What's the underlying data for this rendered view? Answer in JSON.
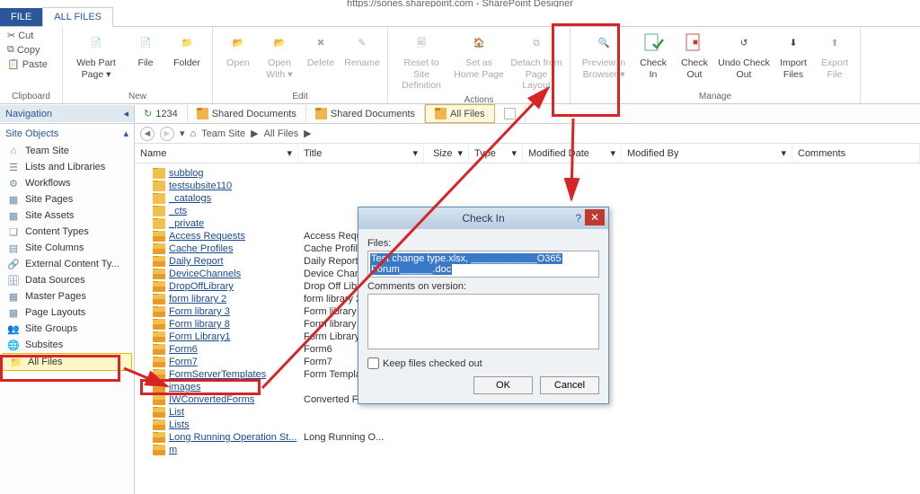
{
  "window": {
    "title": "https://sones.sharepoint.com - SharePoint Designer"
  },
  "tabs": {
    "file": "FILE",
    "all_files": "ALL FILES"
  },
  "ribbon": {
    "clipboard": {
      "label": "Clipboard",
      "cut": "Cut",
      "copy": "Copy",
      "paste": "Paste"
    },
    "new": {
      "label": "New",
      "webpart": "Web Part Page ▾",
      "file": "File",
      "folder": "Folder"
    },
    "edit": {
      "label": "Edit",
      "open": "Open",
      "openwith": "Open With ▾",
      "delete": "Delete",
      "rename": "Rename"
    },
    "actions": {
      "label": "Actions",
      "reset": "Reset to Site Definition",
      "setas": "Set as Home Page",
      "detach": "Detach from Page Layout"
    },
    "manage": {
      "label": "Manage",
      "preview": "Preview in Browser ▾",
      "checkin": "Check In",
      "checkout": "Check Out",
      "undo": "Undo Check Out",
      "import": "Import Files",
      "export": "Export File"
    }
  },
  "nav": {
    "navigation": "Navigation",
    "tabs": [
      "1234",
      "Shared Documents",
      "Shared Documents",
      "All Files"
    ],
    "active_tab": 3
  },
  "sidebar": {
    "header": "Site Objects",
    "items": [
      {
        "label": "Team Site"
      },
      {
        "label": "Lists and Libraries"
      },
      {
        "label": "Workflows"
      },
      {
        "label": "Site Pages"
      },
      {
        "label": "Site Assets"
      },
      {
        "label": "Content Types"
      },
      {
        "label": "Site Columns"
      },
      {
        "label": "External Content Ty..."
      },
      {
        "label": "Data Sources"
      },
      {
        "label": "Master Pages"
      },
      {
        "label": "Page Layouts"
      },
      {
        "label": "Site Groups"
      },
      {
        "label": "Subsites"
      },
      {
        "label": "All Files"
      }
    ],
    "selected": 13
  },
  "breadcrumb": {
    "root": "Team Site",
    "path": "All Files",
    "sep": "▶"
  },
  "columns": [
    "Name",
    "Title",
    "Size",
    "Type",
    "Modified Date",
    "Modified By",
    "Comments"
  ],
  "files": [
    {
      "name": "subblog",
      "title": ""
    },
    {
      "name": "testsubsite110",
      "title": ""
    },
    {
      "name": "_catalogs",
      "title": ""
    },
    {
      "name": "_cts",
      "title": ""
    },
    {
      "name": "_private",
      "title": ""
    },
    {
      "name": "Access Requests",
      "title": "Access Reque"
    },
    {
      "name": "Cache Profiles",
      "title": "Cache Profile"
    },
    {
      "name": "Daily Report",
      "title": "Daily Report"
    },
    {
      "name": "DeviceChannels",
      "title": "Device Chann"
    },
    {
      "name": "DropOffLibrary",
      "title": "Drop Off Libr"
    },
    {
      "name": "form library 2",
      "title": "form library 2"
    },
    {
      "name": "Form library 3",
      "title": "Form library 3"
    },
    {
      "name": "Form library 8",
      "title": "Form library 8"
    },
    {
      "name": "Form Library1",
      "title": "Form Library1"
    },
    {
      "name": "Form6",
      "title": "Form6"
    },
    {
      "name": "Form7",
      "title": "Form7"
    },
    {
      "name": "FormServerTemplates",
      "title": "Form Templat"
    },
    {
      "name": "images",
      "title": ""
    },
    {
      "name": "IWConvertedForms",
      "title": "Converted Fo"
    },
    {
      "name": "List",
      "title": ""
    },
    {
      "name": "Lists",
      "title": ""
    },
    {
      "name": "Long Running Operation St...",
      "title": "Long Running O..."
    },
    {
      "name": "m",
      "title": ""
    }
  ],
  "dialog": {
    "title": "Check In",
    "files_label": "Files:",
    "file_line_1": "Test change type.xlsx, ____________O365",
    "file_line_2": "Forum______.doc",
    "comments_label": "Comments on version:",
    "keep": "Keep files checked out",
    "ok": "OK",
    "cancel": "Cancel"
  }
}
